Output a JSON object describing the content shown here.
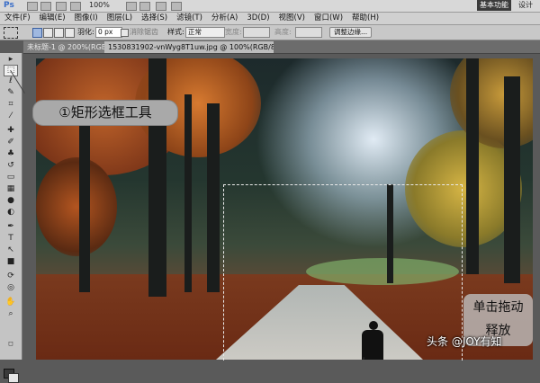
{
  "app": {
    "logo": "Ps",
    "zoom": "100%",
    "workspace_active": "基本功能",
    "workspace_other": "设计"
  },
  "menu": [
    "文件(F)",
    "编辑(E)",
    "图像(I)",
    "图层(L)",
    "选择(S)",
    "滤镜(T)",
    "分析(A)",
    "3D(D)",
    "视图(V)",
    "窗口(W)",
    "帮助(H)"
  ],
  "options": {
    "feather_label": "羽化:",
    "feather_value": "0 px",
    "antialias_label": "消除锯齿",
    "style_label": "样式:",
    "style_value": "正常",
    "width_label": "宽度:",
    "height_label": "高度:",
    "refine_button": "调整边缘..."
  },
  "tabs": [
    {
      "label": "未标题-1 @ 200%(RGB/8) *",
      "active": false
    },
    {
      "label": "1530831902-vnWyg8T1uw.jpg @ 100%(RGB/8#)",
      "active": true
    }
  ],
  "tab_close_glyph": "×",
  "tools": [
    "move-tool",
    "rectangular-marquee-tool",
    "lasso-tool",
    "quick-selection-tool",
    "crop-tool",
    "eyedropper-tool",
    "healing-brush-tool",
    "brush-tool",
    "clone-stamp-tool",
    "history-brush-tool",
    "eraser-tool",
    "gradient-tool",
    "blur-tool",
    "dodge-tool",
    "pen-tool",
    "type-tool",
    "path-selection-tool",
    "shape-tool",
    "3d-rotate-tool",
    "3d-orbit-tool",
    "hand-tool",
    "zoom-tool"
  ],
  "callouts": {
    "tool_callout": "①矩形选框工具",
    "drag_line1": "单击拖动",
    "drag_line2": "释放"
  },
  "watermark": "头条 @JOY有知",
  "colors": {
    "workspace_active_bg": "#3b3b3b",
    "selected_mode": "#9fb8e0"
  }
}
